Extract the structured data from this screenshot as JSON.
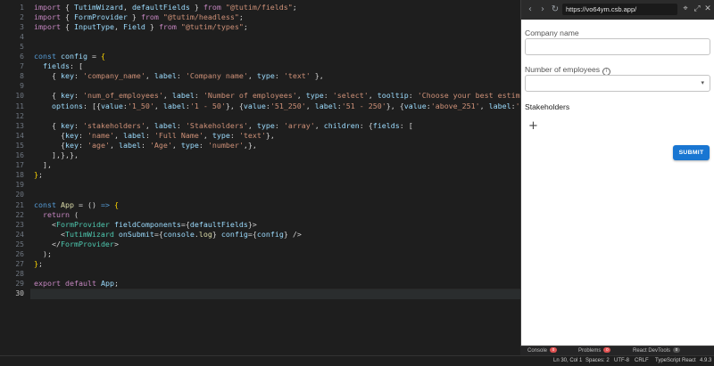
{
  "editor": {
    "current_line": 30,
    "lines": [
      {
        "n": 1,
        "tokens": [
          [
            "kw",
            "import"
          ],
          [
            "punc",
            " { "
          ],
          [
            "var",
            "TutimWizard"
          ],
          [
            "punc",
            ", "
          ],
          [
            "var",
            "defaultFields"
          ],
          [
            "punc",
            " } "
          ],
          [
            "kw",
            "from"
          ],
          [
            "punc",
            " "
          ],
          [
            "str",
            "\"@tutim/fields\""
          ],
          [
            "punc",
            ";"
          ]
        ]
      },
      {
        "n": 2,
        "tokens": [
          [
            "kw",
            "import"
          ],
          [
            "punc",
            " { "
          ],
          [
            "var",
            "FormProvider"
          ],
          [
            "punc",
            " } "
          ],
          [
            "kw",
            "from"
          ],
          [
            "punc",
            " "
          ],
          [
            "str",
            "\"@tutim/headless\""
          ],
          [
            "punc",
            ";"
          ]
        ]
      },
      {
        "n": 3,
        "tokens": [
          [
            "kw",
            "import"
          ],
          [
            "punc",
            " { "
          ],
          [
            "var",
            "InputType"
          ],
          [
            "punc",
            ", "
          ],
          [
            "var",
            "Field"
          ],
          [
            "punc",
            " } "
          ],
          [
            "kw",
            "from"
          ],
          [
            "punc",
            " "
          ],
          [
            "str",
            "\"@tutim/types\""
          ],
          [
            "punc",
            ";"
          ]
        ]
      },
      {
        "n": 4,
        "tokens": []
      },
      {
        "n": 5,
        "tokens": []
      },
      {
        "n": 6,
        "tokens": [
          [
            "decl",
            "const"
          ],
          [
            "punc",
            " "
          ],
          [
            "var",
            "config"
          ],
          [
            "punc",
            " = "
          ],
          [
            "br",
            "{"
          ]
        ]
      },
      {
        "n": 7,
        "tokens": [
          [
            "punc",
            "  "
          ],
          [
            "var",
            "fields"
          ],
          [
            "punc",
            ": ["
          ]
        ]
      },
      {
        "n": 8,
        "tokens": [
          [
            "punc",
            "    { "
          ],
          [
            "var",
            "key"
          ],
          [
            "punc",
            ": "
          ],
          [
            "str",
            "'company_name'"
          ],
          [
            "punc",
            ", "
          ],
          [
            "var",
            "label"
          ],
          [
            "punc",
            ": "
          ],
          [
            "str",
            "'Company name'"
          ],
          [
            "punc",
            ", "
          ],
          [
            "var",
            "type"
          ],
          [
            "punc",
            ": "
          ],
          [
            "str",
            "'text'"
          ],
          [
            "punc",
            " },"
          ]
        ]
      },
      {
        "n": 9,
        "tokens": []
      },
      {
        "n": 10,
        "tokens": [
          [
            "punc",
            "    { "
          ],
          [
            "var",
            "key"
          ],
          [
            "punc",
            ": "
          ],
          [
            "str",
            "'num_of_employees'"
          ],
          [
            "punc",
            ", "
          ],
          [
            "var",
            "label"
          ],
          [
            "punc",
            ": "
          ],
          [
            "str",
            "'Number of employees'"
          ],
          [
            "punc",
            ", "
          ],
          [
            "var",
            "type"
          ],
          [
            "punc",
            ": "
          ],
          [
            "str",
            "'select'"
          ],
          [
            "punc",
            ", "
          ],
          [
            "var",
            "tooltip"
          ],
          [
            "punc",
            ": "
          ],
          [
            "str",
            "'Choose your best estimation'"
          ],
          [
            "punc",
            ","
          ]
        ]
      },
      {
        "n": 11,
        "tokens": [
          [
            "punc",
            "    "
          ],
          [
            "var",
            "options"
          ],
          [
            "punc",
            ": [{"
          ],
          [
            "var",
            "value"
          ],
          [
            "punc",
            ":"
          ],
          [
            "str",
            "'1_50'"
          ],
          [
            "punc",
            ", "
          ],
          [
            "var",
            "label"
          ],
          [
            "punc",
            ":"
          ],
          [
            "str",
            "'1 - 50'"
          ],
          [
            "punc",
            "}, {"
          ],
          [
            "var",
            "value"
          ],
          [
            "punc",
            ":"
          ],
          [
            "str",
            "'51_250'"
          ],
          [
            "punc",
            ", "
          ],
          [
            "var",
            "label"
          ],
          [
            "punc",
            ":"
          ],
          [
            "str",
            "'51 - 250'"
          ],
          [
            "punc",
            "}, {"
          ],
          [
            "var",
            "value"
          ],
          [
            "punc",
            ":"
          ],
          [
            "str",
            "'above_251'"
          ],
          [
            "punc",
            ", "
          ],
          [
            "var",
            "label"
          ],
          [
            "punc",
            ":"
          ],
          [
            "str",
            "'251 +'"
          ],
          [
            "punc",
            "}]"
          ]
        ]
      },
      {
        "n": 12,
        "tokens": []
      },
      {
        "n": 13,
        "tokens": [
          [
            "punc",
            "    { "
          ],
          [
            "var",
            "key"
          ],
          [
            "punc",
            ": "
          ],
          [
            "str",
            "'stakeholders'"
          ],
          [
            "punc",
            ", "
          ],
          [
            "var",
            "label"
          ],
          [
            "punc",
            ": "
          ],
          [
            "str",
            "'Stakeholders'"
          ],
          [
            "punc",
            ", "
          ],
          [
            "var",
            "type"
          ],
          [
            "punc",
            ": "
          ],
          [
            "str",
            "'array'"
          ],
          [
            "punc",
            ", "
          ],
          [
            "var",
            "children"
          ],
          [
            "punc",
            ": {"
          ],
          [
            "var",
            "fields"
          ],
          [
            "punc",
            ": ["
          ]
        ]
      },
      {
        "n": 14,
        "tokens": [
          [
            "punc",
            "      {"
          ],
          [
            "var",
            "key"
          ],
          [
            "punc",
            ": "
          ],
          [
            "str",
            "'name'"
          ],
          [
            "punc",
            ", "
          ],
          [
            "var",
            "label"
          ],
          [
            "punc",
            ": "
          ],
          [
            "str",
            "'Full Name'"
          ],
          [
            "punc",
            ", "
          ],
          [
            "var",
            "type"
          ],
          [
            "punc",
            ": "
          ],
          [
            "str",
            "'text'"
          ],
          [
            "punc",
            "},"
          ]
        ]
      },
      {
        "n": 15,
        "tokens": [
          [
            "punc",
            "      {"
          ],
          [
            "var",
            "key"
          ],
          [
            "punc",
            ": "
          ],
          [
            "str",
            "'age'"
          ],
          [
            "punc",
            ", "
          ],
          [
            "var",
            "label"
          ],
          [
            "punc",
            ": "
          ],
          [
            "str",
            "'Age'"
          ],
          [
            "punc",
            ", "
          ],
          [
            "var",
            "type"
          ],
          [
            "punc",
            ": "
          ],
          [
            "str",
            "'number'"
          ],
          [
            "punc",
            ",},"
          ]
        ]
      },
      {
        "n": 16,
        "tokens": [
          [
            "punc",
            "    ],},},"
          ]
        ]
      },
      {
        "n": 17,
        "tokens": [
          [
            "punc",
            "  ],"
          ]
        ]
      },
      {
        "n": 18,
        "tokens": [
          [
            "br",
            "}"
          ],
          [
            "punc",
            ";"
          ]
        ]
      },
      {
        "n": 19,
        "tokens": []
      },
      {
        "n": 20,
        "tokens": []
      },
      {
        "n": 21,
        "tokens": [
          [
            "decl",
            "const"
          ],
          [
            "punc",
            " "
          ],
          [
            "fn",
            "App"
          ],
          [
            "punc",
            " = () "
          ],
          [
            "decl",
            "=>"
          ],
          [
            "punc",
            " "
          ],
          [
            "br",
            "{"
          ]
        ]
      },
      {
        "n": 22,
        "tokens": [
          [
            "punc",
            "  "
          ],
          [
            "kw",
            "return"
          ],
          [
            "punc",
            " ("
          ]
        ]
      },
      {
        "n": 23,
        "tokens": [
          [
            "punc",
            "    <"
          ],
          [
            "tag",
            "FormProvider"
          ],
          [
            "punc",
            " "
          ],
          [
            "attr",
            "fieldComponents"
          ],
          [
            "punc",
            "={"
          ],
          [
            "var",
            "defaultFields"
          ],
          [
            "punc",
            "}>"
          ]
        ]
      },
      {
        "n": 24,
        "tokens": [
          [
            "punc",
            "      <"
          ],
          [
            "tag",
            "TutimWizard"
          ],
          [
            "punc",
            " "
          ],
          [
            "attr",
            "onSubmit"
          ],
          [
            "punc",
            "={"
          ],
          [
            "var",
            "console"
          ],
          [
            "punc",
            "."
          ],
          [
            "fn",
            "log"
          ],
          [
            "punc",
            "} "
          ],
          [
            "attr",
            "config"
          ],
          [
            "punc",
            "={"
          ],
          [
            "var",
            "config"
          ],
          [
            "punc",
            "} />"
          ]
        ]
      },
      {
        "n": 25,
        "tokens": [
          [
            "punc",
            "    </"
          ],
          [
            "tag",
            "FormProvider"
          ],
          [
            "punc",
            ">"
          ]
        ]
      },
      {
        "n": 26,
        "tokens": [
          [
            "punc",
            "  );"
          ]
        ]
      },
      {
        "n": 27,
        "tokens": [
          [
            "br",
            "}"
          ],
          [
            "punc",
            ";"
          ]
        ]
      },
      {
        "n": 28,
        "tokens": []
      },
      {
        "n": 29,
        "tokens": [
          [
            "kw",
            "export"
          ],
          [
            "punc",
            " "
          ],
          [
            "kw",
            "default"
          ],
          [
            "punc",
            " "
          ],
          [
            "var",
            "App"
          ],
          [
            "punc",
            ";"
          ]
        ]
      },
      {
        "n": 30,
        "tokens": []
      }
    ]
  },
  "browser": {
    "url": "https://vo64ym.csb.app/",
    "nav": {
      "back": "‹",
      "forward": "›",
      "refresh": "↻"
    },
    "tool_icons": [
      "⌖",
      "⤢",
      "✕"
    ]
  },
  "form": {
    "company_label": "Company name",
    "employees_label": "Number of employees",
    "info_glyph": "i",
    "select_caret": "▾",
    "stakeholders_label": "Stakeholders",
    "add_glyph": "+",
    "submit_label": "SUBMIT",
    "accent": "#1976d2"
  },
  "panel": {
    "tabs": [
      {
        "label": "Console",
        "badge": "0",
        "badge_color": "#e05252"
      },
      {
        "label": "Problems",
        "badge": "0",
        "badge_color": "#e05252"
      },
      {
        "label": "React DevTools",
        "badge": "0",
        "badge_color": "#555555"
      }
    ]
  },
  "status": {
    "position": "Ln 30, Col 1",
    "spaces": "Spaces: 2",
    "encoding": "UTF-8",
    "eol": "CRLF",
    "language": "TypeScript React",
    "version": "4.9.3"
  }
}
